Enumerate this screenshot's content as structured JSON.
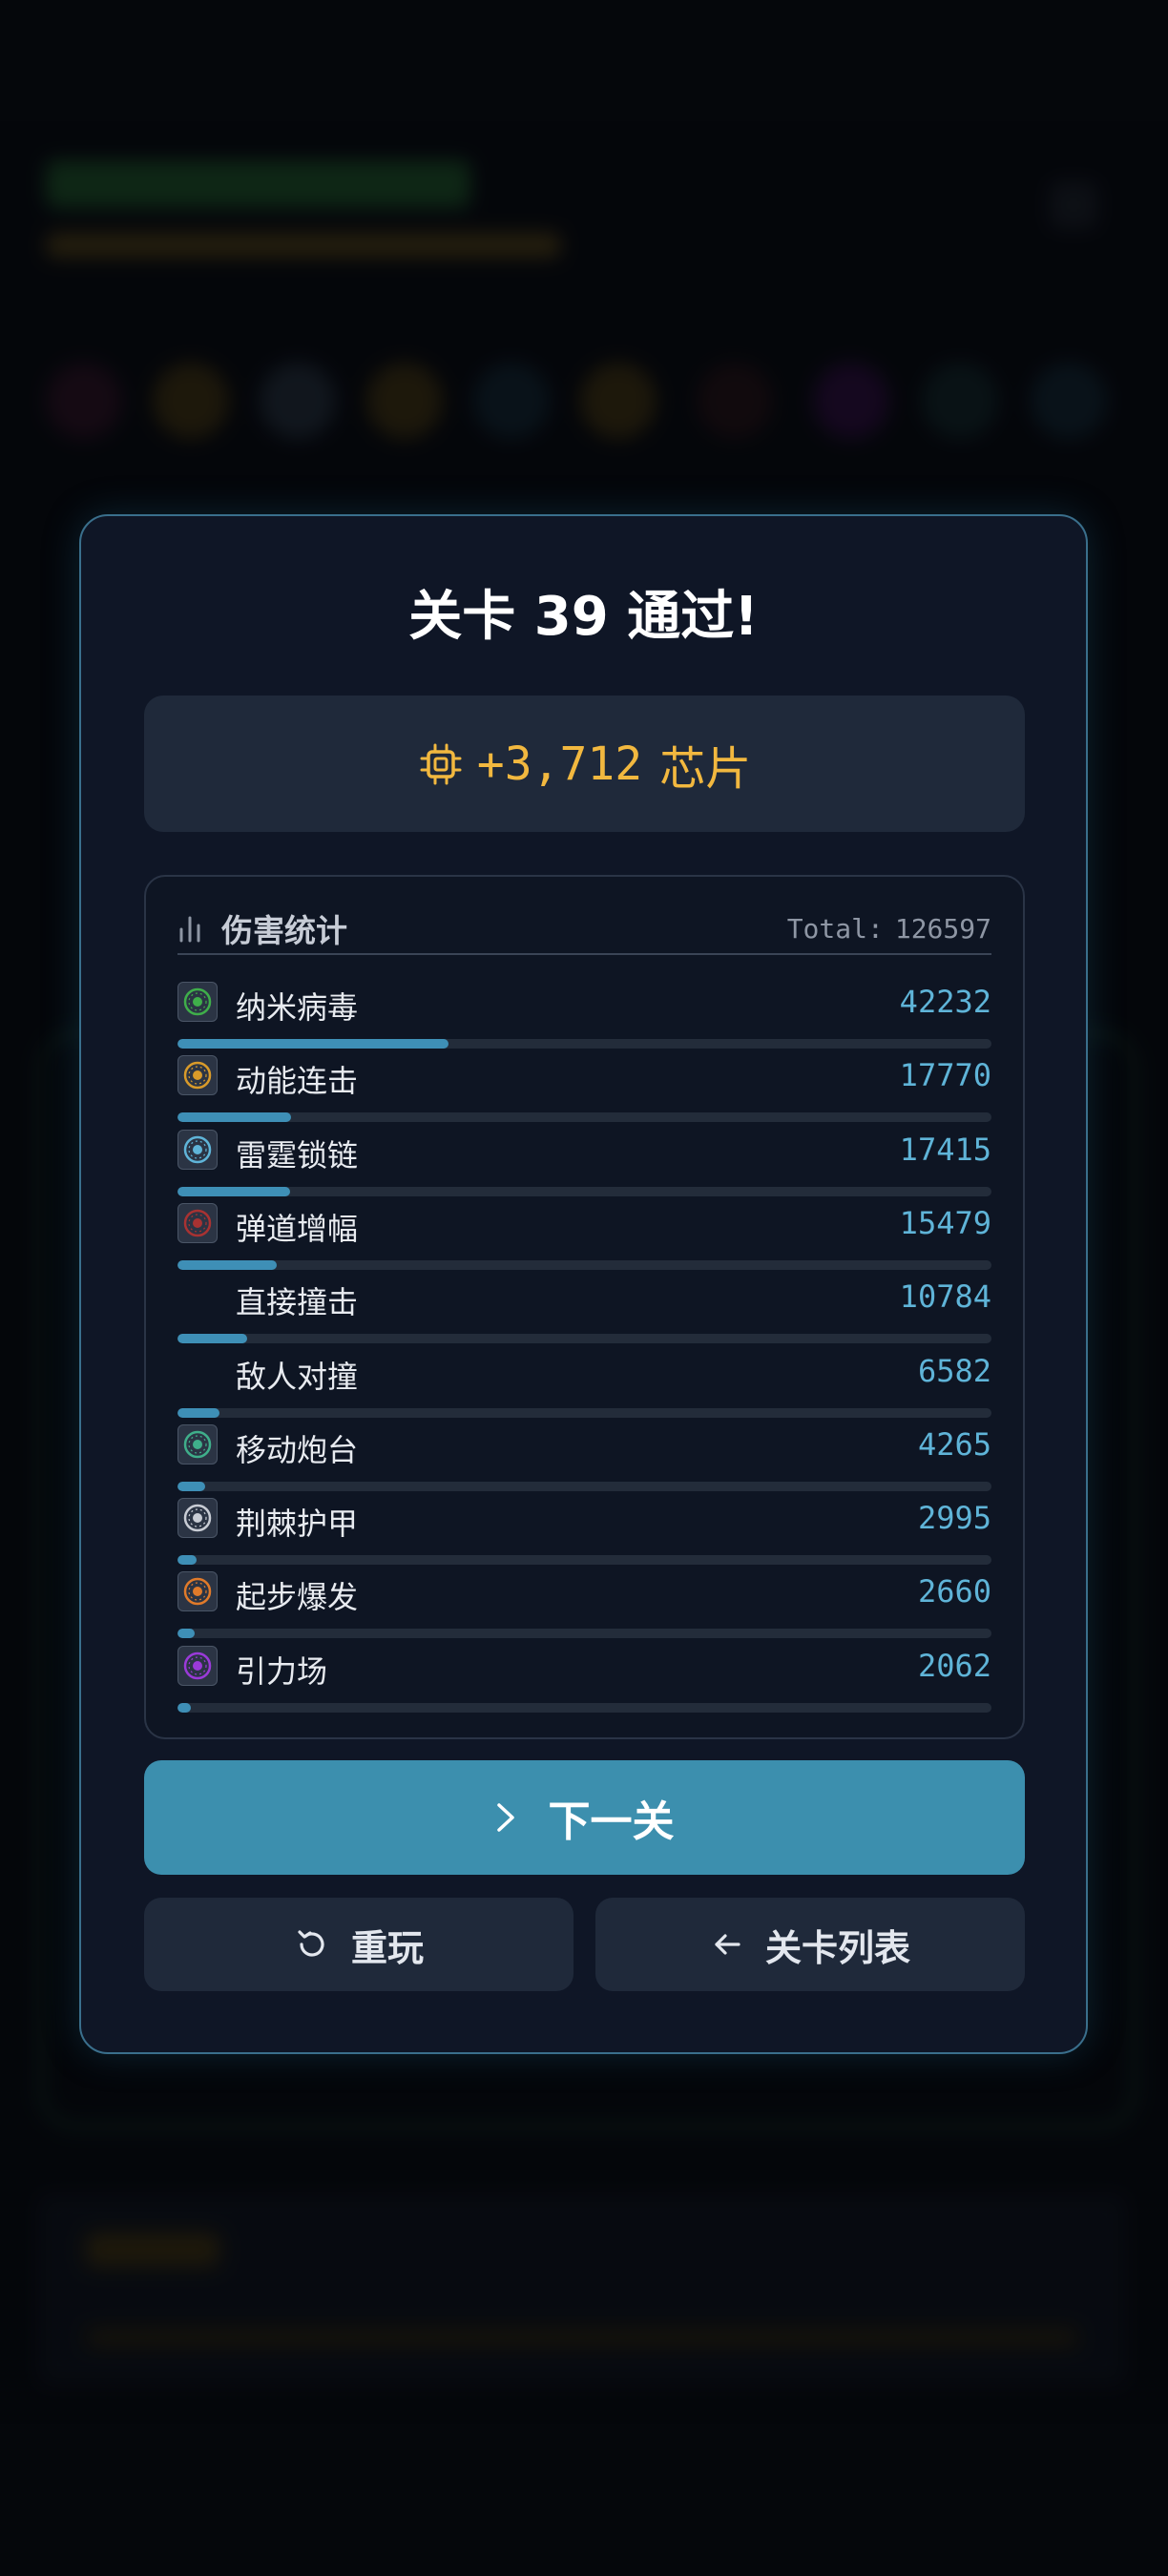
{
  "colors": {
    "accent": "#3c8fae",
    "chip_gold": "#f2b83f",
    "value_blue": "#5fb4d8",
    "modal_bg": "#0f1626",
    "modal_border": "#3a6f8c"
  },
  "modal": {
    "title": "关卡 39 通过!",
    "reward": {
      "icon": "chip-icon",
      "amount": "+3,712",
      "unit": "芯片"
    },
    "damage_stats": {
      "icon": "bar-chart-icon",
      "title": "伤害统计",
      "total_label": "Total:",
      "total_value": "126597",
      "rows": [
        {
          "name": "纳米病毒",
          "value": "42232",
          "fraction": 0.333,
          "icon": "nano-virus-icon",
          "color": "#3fae4a"
        },
        {
          "name": "动能连击",
          "value": "17770",
          "fraction": 0.14,
          "icon": "kinetic-combo-icon",
          "color": "#d89a2a"
        },
        {
          "name": "雷霆锁链",
          "value": "17415",
          "fraction": 0.138,
          "icon": "thunder-chain-icon",
          "color": "#5fb4d8"
        },
        {
          "name": "弹道增幅",
          "value": "15479",
          "fraction": 0.122,
          "icon": "ballistic-boost-icon",
          "color": "#a83232"
        },
        {
          "name": "直接撞击",
          "value": "10784",
          "fraction": 0.085,
          "icon": "",
          "color": ""
        },
        {
          "name": "敌人对撞",
          "value": "6582",
          "fraction": 0.052,
          "icon": "",
          "color": ""
        },
        {
          "name": "移动炮台",
          "value": "4265",
          "fraction": 0.034,
          "icon": "mobile-turret-icon",
          "color": "#3fae8a"
        },
        {
          "name": "荆棘护甲",
          "value": "2995",
          "fraction": 0.024,
          "icon": "thorn-armor-icon",
          "color": "#c8ccd4"
        },
        {
          "name": "起步爆发",
          "value": "2660",
          "fraction": 0.021,
          "icon": "start-burst-icon",
          "color": "#e07a2a"
        },
        {
          "name": "引力场",
          "value": "2062",
          "fraction": 0.016,
          "icon": "gravity-field-icon",
          "color": "#9a3ad8"
        }
      ]
    },
    "buttons": {
      "next": {
        "label": "下一关",
        "icon": "chevron-right-icon"
      },
      "replay": {
        "label": "重玩",
        "icon": "replay-icon"
      },
      "level_list": {
        "label": "关卡列表",
        "icon": "arrow-left-icon"
      }
    }
  }
}
